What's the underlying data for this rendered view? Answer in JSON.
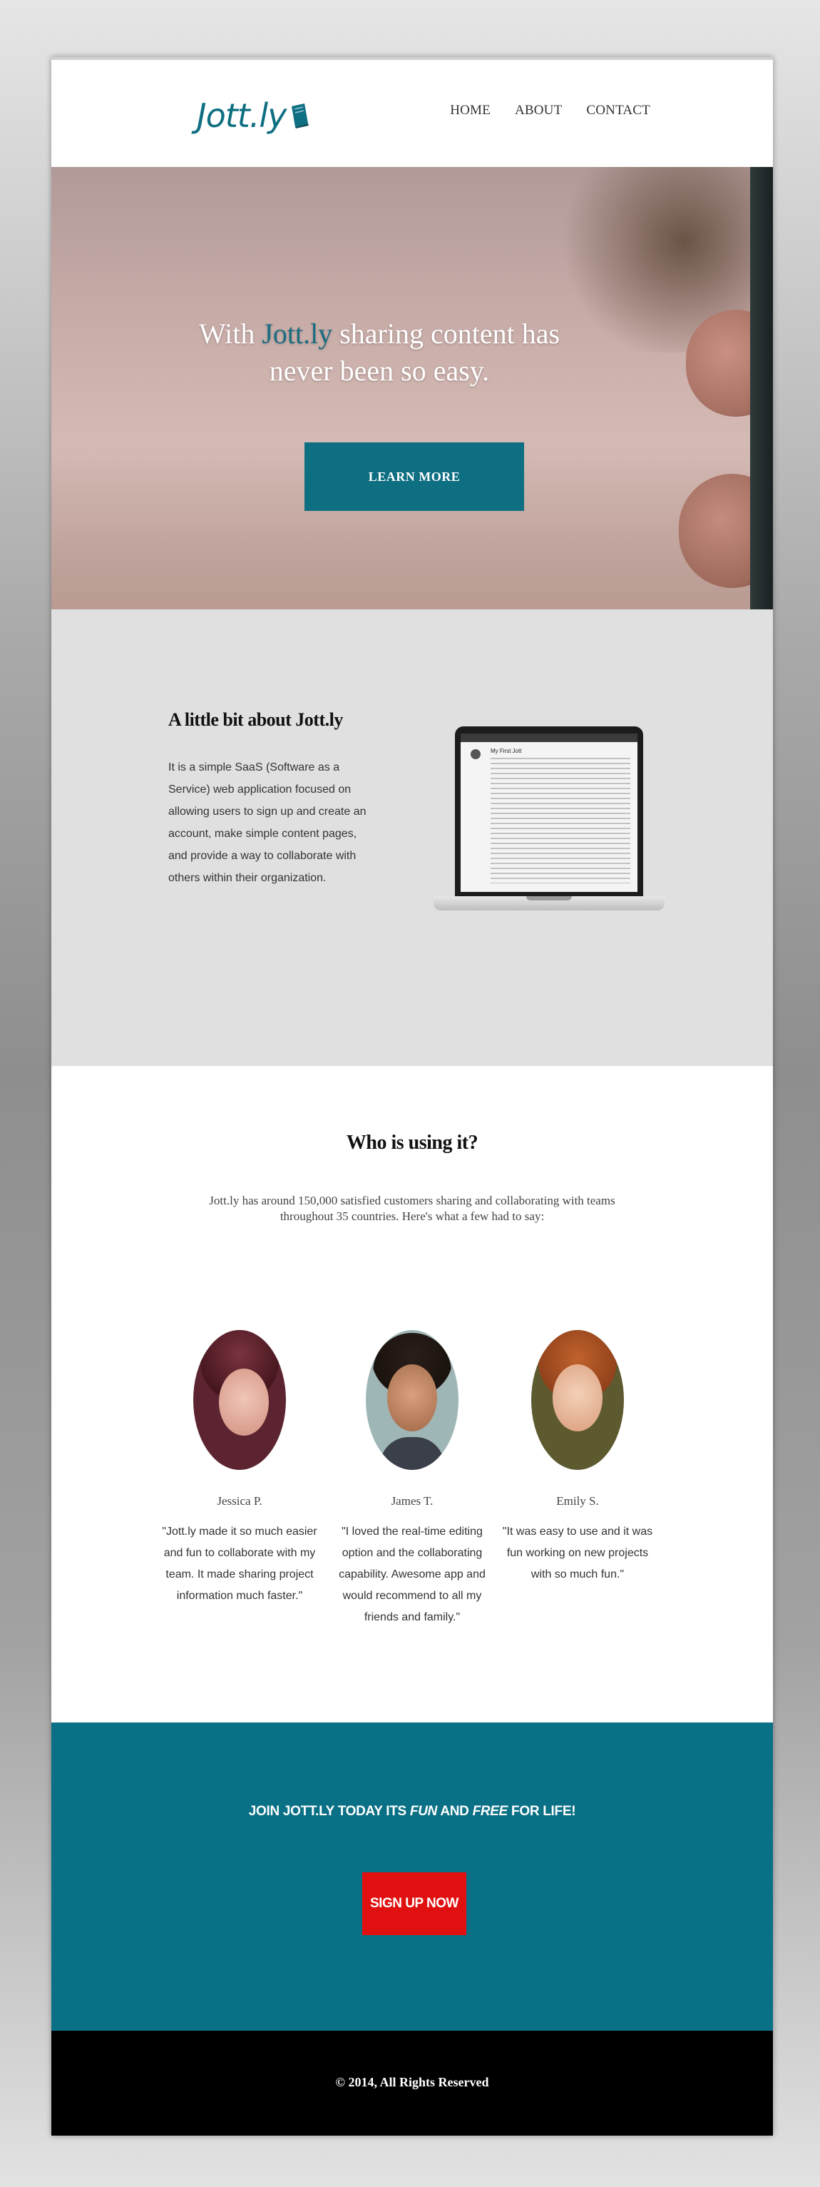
{
  "nav": {
    "logo": "Jott.ly",
    "items": [
      "HOME",
      "ABOUT",
      "CONTACT"
    ]
  },
  "hero": {
    "title_before": "With ",
    "title_brand": "Jott.ly",
    "title_after": " sharing content has never been so easy.",
    "button": "LEARN MORE"
  },
  "about": {
    "heading": "A little bit about Jott.ly",
    "body": "It is a simple SaaS (Software as a Service) web application focused on allowing users to sign up and create an account, make simple content pages, and provide a way to collaborate with others within their organization.",
    "screen_title": "My First Jott"
  },
  "who": {
    "heading": "Who is using it?",
    "intro": "Jott.ly has around 150,000 satisfied customers sharing and collaborating with teams throughout 35 countries. Here's what a few had to say:",
    "people": [
      {
        "name": "Jessica P.",
        "quote": "\"Jott.ly made it so much easier and fun to collaborate with my team. It made sharing project information much faster.\""
      },
      {
        "name": "James T.",
        "quote": "\"I loved the real-time editing option and the collaborating capability. Awesome app and would recommend to all my friends and family.\""
      },
      {
        "name": "Emily S.",
        "quote": "\"It was easy to use and it was fun working on new projects with so much fun.\""
      }
    ]
  },
  "join": {
    "cta_part1": "JOIN JOTT.LY TODAY ITS ",
    "cta_fun": "FUN",
    "cta_part2": " AND ",
    "cta_free": "FREE",
    "cta_part3": " FOR LIFE!",
    "button": "SIGN UP NOW"
  },
  "footer": {
    "copyright": "© 2014, All Rights Reserved"
  },
  "colors": {
    "brand_teal": "#0e6e82",
    "signup_red": "#e01010",
    "about_bg": "#e0e0e0",
    "footer_bg": "#000000"
  }
}
